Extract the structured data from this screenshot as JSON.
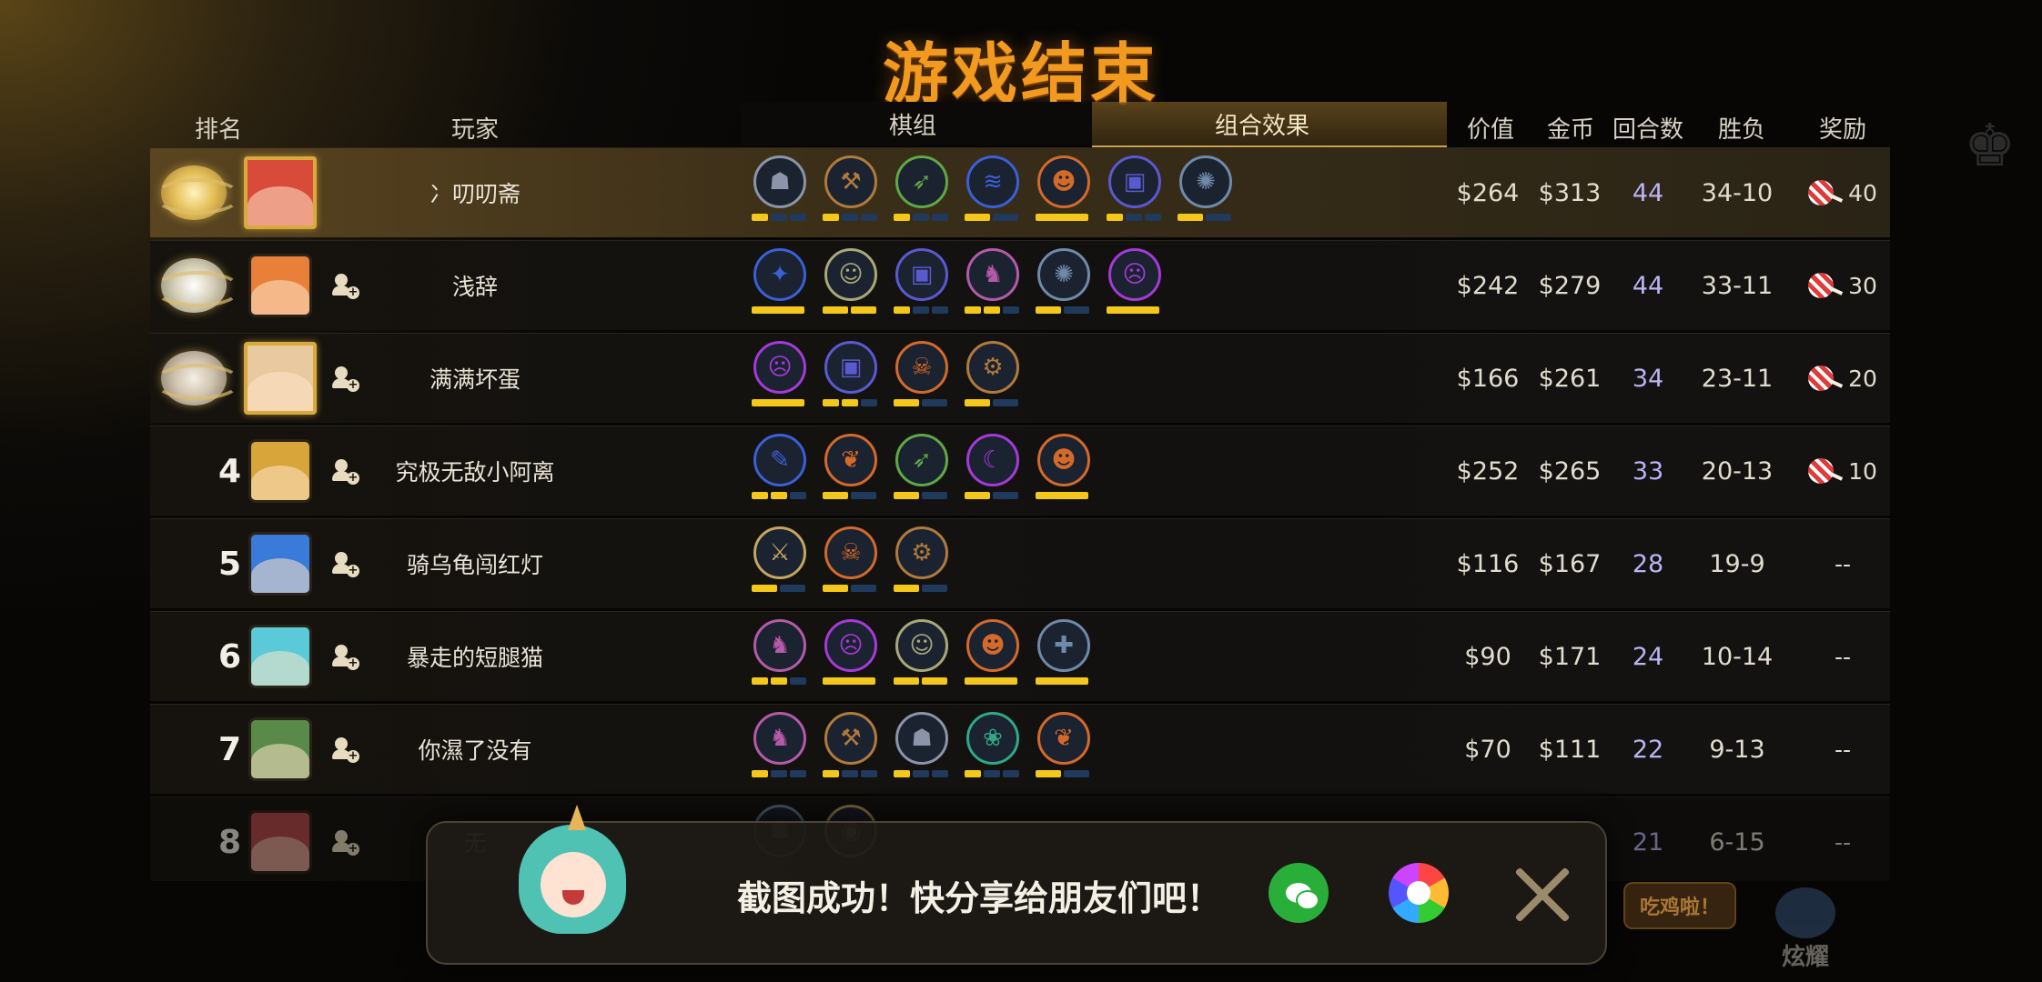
{
  "title": "游戏结束",
  "headers": {
    "rank": "排名",
    "player": "玩家",
    "pieces": "棋组",
    "combo": "组合效果",
    "value": "价值",
    "gold": "金币",
    "rounds": "回合数",
    "win_loss": "胜负",
    "reward": "奖励"
  },
  "trait_colors": {
    "gray": "#8b94a8",
    "bronze": "#b07a3c",
    "green": "#5fa845",
    "blue": "#3b5fd6",
    "orange": "#d46a2a",
    "indigo": "#5a5ad0",
    "slate": "#6f8aa8",
    "purple": "#a43ad8",
    "pink": "#b35aa8",
    "teal": "#2fa885",
    "khaki": "#c4a660",
    "olive": "#a8a878"
  },
  "rows": [
    {
      "rank": "1",
      "medal": "gold",
      "name": "冫叨叨斋",
      "value": "$264",
      "gold": "$313",
      "rounds": "44",
      "win_loss": "34-10",
      "reward": "40",
      "traits": [
        {
          "icon": "golem-icon",
          "glyph": "☗",
          "color": "gray",
          "pips": [
            1,
            0,
            0
          ]
        },
        {
          "icon": "axe-icon",
          "glyph": "⚒",
          "color": "bronze",
          "pips": [
            1,
            0,
            0
          ]
        },
        {
          "icon": "bow-icon",
          "glyph": "➶",
          "color": "green",
          "pips": [
            1,
            0,
            0
          ]
        },
        {
          "icon": "fish-icon",
          "glyph": "≋",
          "color": "blue",
          "pips": [
            1,
            0
          ]
        },
        {
          "icon": "viking-helmet-icon",
          "glyph": "☻",
          "color": "orange",
          "pips": [
            1
          ]
        },
        {
          "icon": "demon-book-icon",
          "glyph": "▣",
          "color": "indigo",
          "pips": [
            1,
            0,
            0
          ]
        },
        {
          "icon": "wolf-paw-icon",
          "glyph": "✺",
          "color": "slate",
          "pips": [
            1,
            0
          ]
        }
      ]
    },
    {
      "rank": "2",
      "medal": "silver",
      "name": "浅辞",
      "value": "$242",
      "gold": "$279",
      "rounds": "44",
      "win_loss": "33-11",
      "reward": "30",
      "traits": [
        {
          "icon": "dragon-icon",
          "glyph": "✦",
          "color": "blue",
          "pips": [
            1
          ]
        },
        {
          "icon": "goblin-icon",
          "glyph": "☺",
          "color": "olive",
          "pips": [
            1,
            1
          ]
        },
        {
          "icon": "demon-book-icon",
          "glyph": "▣",
          "color": "indigo",
          "pips": [
            1,
            0,
            0
          ]
        },
        {
          "icon": "knight-icon",
          "glyph": "♞",
          "color": "pink",
          "pips": [
            1,
            1,
            0
          ]
        },
        {
          "icon": "wolf-paw-icon",
          "glyph": "✺",
          "color": "slate",
          "pips": [
            1,
            0
          ]
        },
        {
          "icon": "demon-face-icon",
          "glyph": "☹",
          "color": "purple",
          "pips": [
            1
          ]
        }
      ]
    },
    {
      "rank": "3",
      "medal": "bronze",
      "name": "满满坏蛋",
      "value": "$166",
      "gold": "$261",
      "rounds": "34",
      "win_loss": "23-11",
      "reward": "20",
      "traits": [
        {
          "icon": "demon-face-icon",
          "glyph": "☹",
          "color": "purple",
          "pips": [
            1
          ]
        },
        {
          "icon": "demon-book-icon",
          "glyph": "▣",
          "color": "indigo",
          "pips": [
            1,
            1,
            0
          ]
        },
        {
          "icon": "beast-icon",
          "glyph": "☠",
          "color": "orange",
          "pips": [
            1,
            0
          ]
        },
        {
          "icon": "mech-gear-icon",
          "glyph": "⚙",
          "color": "bronze",
          "pips": [
            1,
            0
          ]
        }
      ]
    },
    {
      "rank": "4",
      "medal": "",
      "name": "究极无敌小阿离",
      "value": "$252",
      "gold": "$265",
      "rounds": "33",
      "win_loss": "20-13",
      "reward": "10",
      "traits": [
        {
          "icon": "feather-icon",
          "glyph": "✎",
          "color": "blue",
          "pips": [
            1,
            1,
            0
          ]
        },
        {
          "icon": "leaf-icon",
          "glyph": "❦",
          "color": "orange",
          "pips": [
            1,
            0
          ]
        },
        {
          "icon": "bow-icon",
          "glyph": "➶",
          "color": "green",
          "pips": [
            1,
            0
          ]
        },
        {
          "icon": "shadow-icon",
          "glyph": "☾",
          "color": "purple",
          "pips": [
            1,
            0
          ]
        },
        {
          "icon": "viking-helmet-icon",
          "glyph": "☻",
          "color": "orange",
          "pips": [
            1
          ]
        }
      ]
    },
    {
      "rank": "5",
      "medal": "",
      "name": "骑乌龟闯红灯",
      "value": "$116",
      "gold": "$167",
      "rounds": "28",
      "win_loss": "19-9",
      "reward": "--",
      "traits": [
        {
          "icon": "claw-icon",
          "glyph": "⚔",
          "color": "khaki",
          "pips": [
            1,
            0
          ]
        },
        {
          "icon": "beast-icon",
          "glyph": "☠",
          "color": "orange",
          "pips": [
            1,
            0
          ]
        },
        {
          "icon": "mech-gear-icon",
          "glyph": "⚙",
          "color": "bronze",
          "pips": [
            1,
            0
          ]
        }
      ]
    },
    {
      "rank": "6",
      "medal": "",
      "name": "暴走的短腿猫",
      "value": "$90",
      "gold": "$171",
      "rounds": "24",
      "win_loss": "10-14",
      "reward": "--",
      "traits": [
        {
          "icon": "knight-icon",
          "glyph": "♞",
          "color": "pink",
          "pips": [
            1,
            1,
            0
          ]
        },
        {
          "icon": "demon-face-icon",
          "glyph": "☹",
          "color": "purple",
          "pips": [
            1
          ]
        },
        {
          "icon": "goblin-icon",
          "glyph": "☺",
          "color": "olive",
          "pips": [
            1,
            1
          ]
        },
        {
          "icon": "viking-helmet-icon",
          "glyph": "☻",
          "color": "orange",
          "pips": [
            1
          ]
        },
        {
          "icon": "cross-icon",
          "glyph": "✚",
          "color": "slate",
          "pips": [
            1
          ]
        }
      ]
    },
    {
      "rank": "7",
      "medal": "",
      "name": "你濕了没有",
      "value": "$70",
      "gold": "$111",
      "rounds": "22",
      "win_loss": "9-13",
      "reward": "--",
      "traits": [
        {
          "icon": "knight-icon",
          "glyph": "♞",
          "color": "pink",
          "pips": [
            1,
            0,
            0
          ]
        },
        {
          "icon": "axe-icon",
          "glyph": "⚒",
          "color": "bronze",
          "pips": [
            1,
            0,
            0
          ]
        },
        {
          "icon": "golem-icon",
          "glyph": "☗",
          "color": "gray",
          "pips": [
            1,
            0,
            0
          ]
        },
        {
          "icon": "paw-icon",
          "glyph": "❀",
          "color": "teal",
          "pips": [
            1,
            0,
            0
          ]
        },
        {
          "icon": "leaf-icon",
          "glyph": "❦",
          "color": "orange",
          "pips": [
            1,
            0
          ]
        }
      ]
    },
    {
      "rank": "8",
      "medal": "",
      "name": "无",
      "value": "",
      "gold": "",
      "rounds": "21",
      "win_loss": "6-15",
      "reward": "--",
      "traits": [
        {
          "icon": "golem-icon",
          "glyph": "☗",
          "color": "slate",
          "pips": []
        },
        {
          "icon": "shield-icon",
          "glyph": "◉",
          "color": "khaki",
          "pips": []
        }
      ]
    }
  ],
  "toast": {
    "message": "截图成功！快分享给朋友们吧！"
  },
  "corner": {
    "chiji": "吃鸡啦！",
    "xuanyao": "炫耀"
  }
}
